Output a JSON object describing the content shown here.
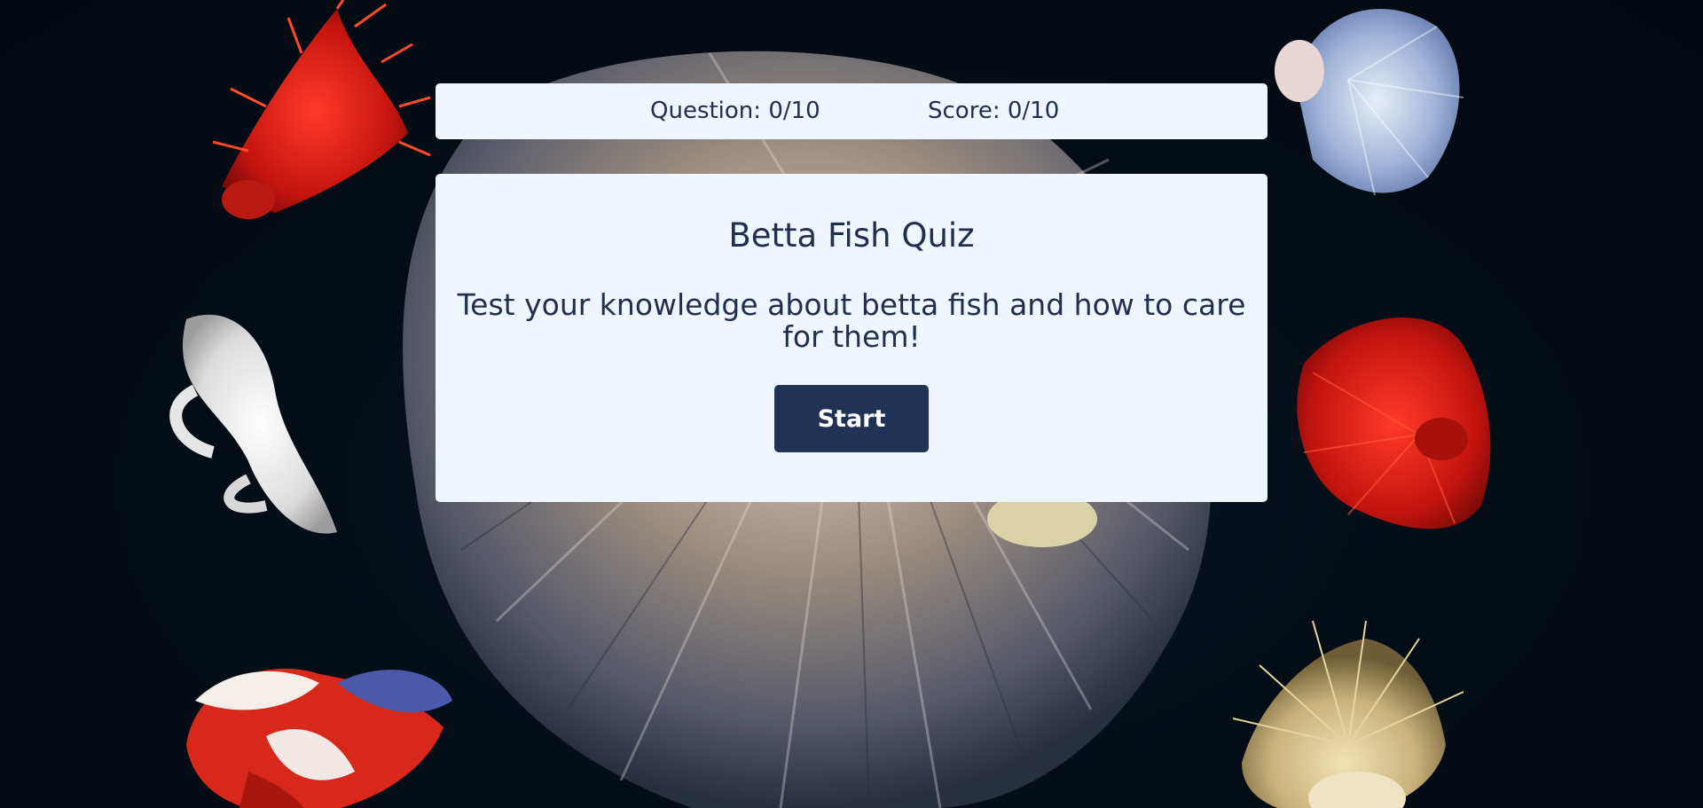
{
  "status": {
    "question": "Question: 0/10",
    "score": "Score: 0/10"
  },
  "quiz": {
    "title": "Betta Fish Quiz",
    "subtitle": "Test your knowledge about betta fish and how to care for them!",
    "start_label": "Start"
  },
  "colors": {
    "panel": "#eff6ff",
    "text": "#1f2f4d",
    "button": "#213355",
    "background": "#030b14"
  }
}
